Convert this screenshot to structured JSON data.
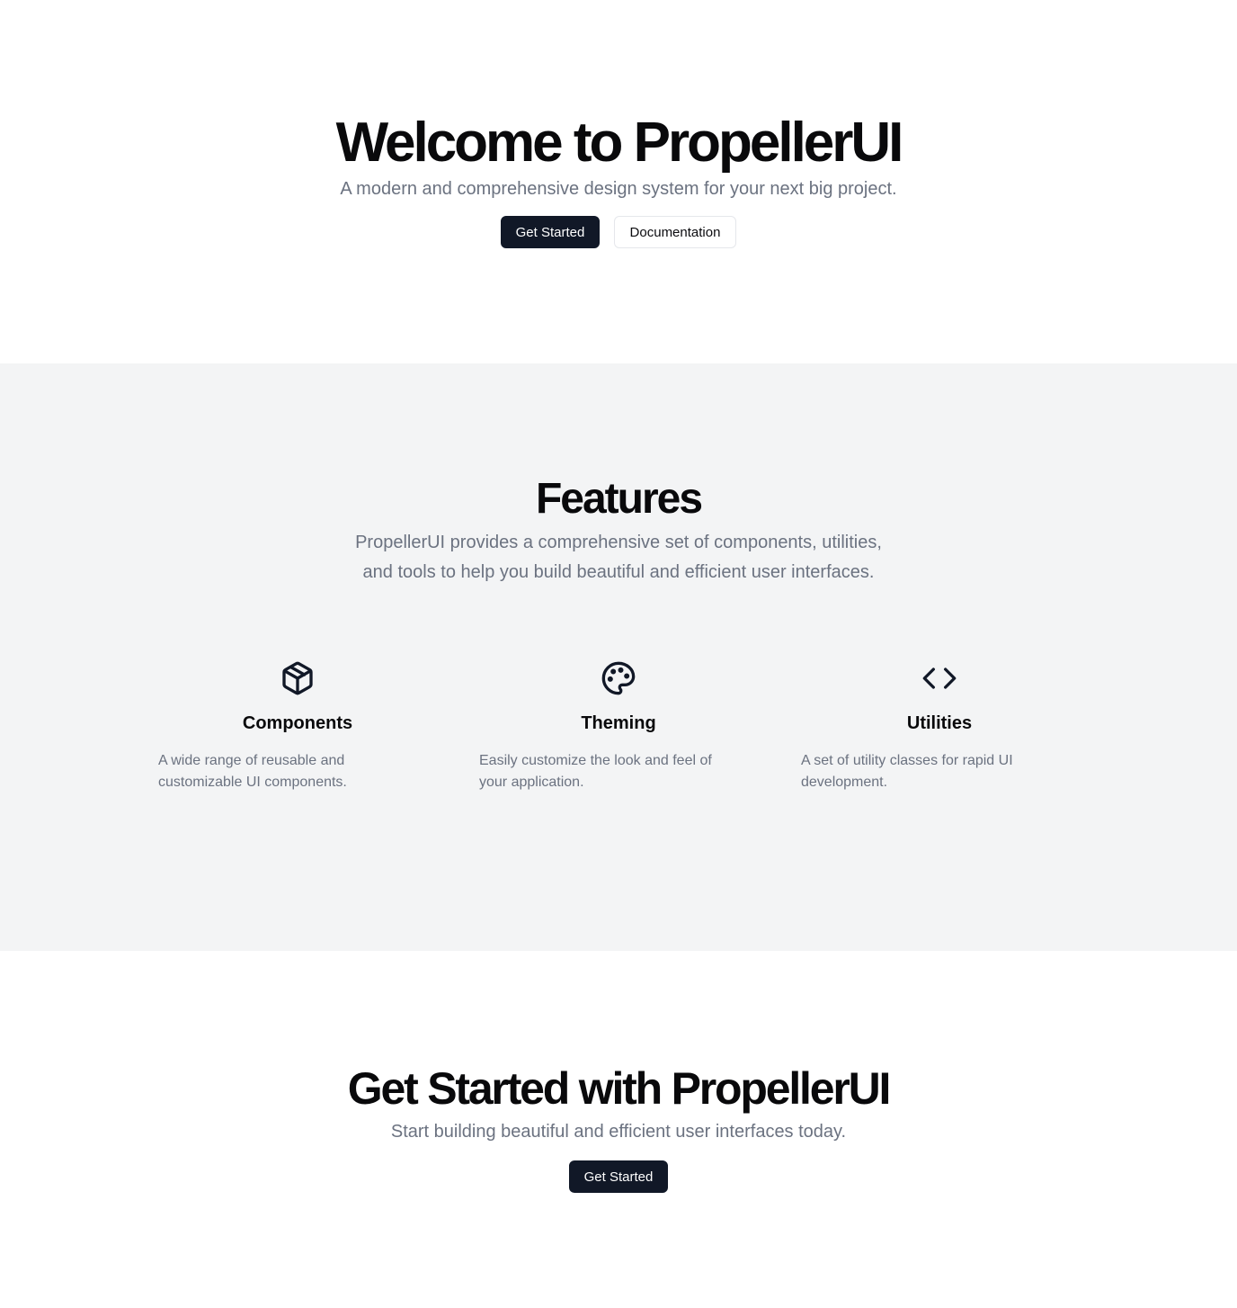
{
  "hero": {
    "title": "Welcome to PropellerUI",
    "subtitle": "A modern and comprehensive design system for your next big project.",
    "primary_button": "Get Started",
    "secondary_button": "Documentation"
  },
  "features": {
    "title": "Features",
    "description": "PropellerUI provides a comprehensive set of components, utilities, and tools to help you build beautiful and efficient user interfaces.",
    "items": [
      {
        "icon": "package-icon",
        "title": "Components",
        "description": "A wide range of reusable and customizable UI components."
      },
      {
        "icon": "palette-icon",
        "title": "Theming",
        "description": "Easily customize the look and feel of your application."
      },
      {
        "icon": "code-icon",
        "title": "Utilities",
        "description": "A set of utility classes for rapid UI development."
      }
    ]
  },
  "cta": {
    "title": "Get Started with PropellerUI",
    "subtitle": "Start building beautiful and efficient user interfaces today.",
    "button": "Get Started"
  },
  "colors": {
    "primary_button_bg": "#111827",
    "section_bg": "#f3f4f5",
    "muted_text": "#6b7280"
  }
}
